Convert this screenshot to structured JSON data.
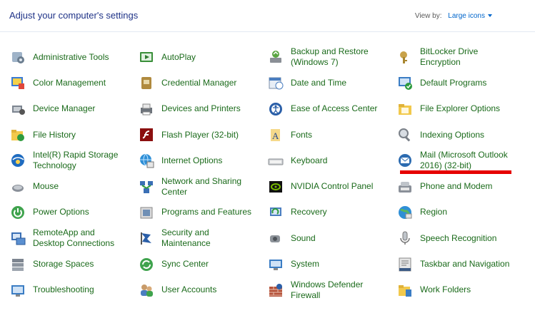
{
  "header": {
    "title": "Adjust your computer's settings",
    "view_by_label": "View by:",
    "view_by_value": "Large icons"
  },
  "colors": {
    "link_green": "#1a6a1a",
    "title_blue": "#1e3287",
    "accent_blue": "#0066cc",
    "annotation_red": "#e60000"
  },
  "items": [
    {
      "label": "Administrative Tools",
      "icon": "admin-tools-icon"
    },
    {
      "label": "AutoPlay",
      "icon": "autoplay-icon"
    },
    {
      "label": "Backup and Restore (Windows 7)",
      "icon": "backup-restore-icon"
    },
    {
      "label": "BitLocker Drive Encryption",
      "icon": "bitlocker-icon"
    },
    {
      "label": "Color Management",
      "icon": "color-management-icon"
    },
    {
      "label": "Credential Manager",
      "icon": "credential-manager-icon"
    },
    {
      "label": "Date and Time",
      "icon": "date-time-icon"
    },
    {
      "label": "Default Programs",
      "icon": "default-programs-icon"
    },
    {
      "label": "Device Manager",
      "icon": "device-manager-icon"
    },
    {
      "label": "Devices and Printers",
      "icon": "devices-printers-icon"
    },
    {
      "label": "Ease of Access Center",
      "icon": "ease-of-access-icon"
    },
    {
      "label": "File Explorer Options",
      "icon": "file-explorer-options-icon"
    },
    {
      "label": "File History",
      "icon": "file-history-icon"
    },
    {
      "label": "Flash Player (32-bit)",
      "icon": "flash-player-icon"
    },
    {
      "label": "Fonts",
      "icon": "fonts-icon"
    },
    {
      "label": "Indexing Options",
      "icon": "indexing-options-icon"
    },
    {
      "label": "Intel(R) Rapid Storage Technology",
      "icon": "intel-rst-icon"
    },
    {
      "label": "Internet Options",
      "icon": "internet-options-icon"
    },
    {
      "label": "Keyboard",
      "icon": "keyboard-icon"
    },
    {
      "label": "Mail (Microsoft Outlook 2016) (32-bit)",
      "icon": "mail-icon"
    },
    {
      "label": "Mouse",
      "icon": "mouse-icon"
    },
    {
      "label": "Network and Sharing Center",
      "icon": "network-sharing-icon"
    },
    {
      "label": "NVIDIA Control Panel",
      "icon": "nvidia-icon"
    },
    {
      "label": "Phone and Modem",
      "icon": "phone-modem-icon"
    },
    {
      "label": "Power Options",
      "icon": "power-options-icon"
    },
    {
      "label": "Programs and Features",
      "icon": "programs-features-icon"
    },
    {
      "label": "Recovery",
      "icon": "recovery-icon"
    },
    {
      "label": "Region",
      "icon": "region-icon"
    },
    {
      "label": "RemoteApp and Desktop Connections",
      "icon": "remoteapp-icon"
    },
    {
      "label": "Security and Maintenance",
      "icon": "security-maintenance-icon"
    },
    {
      "label": "Sound",
      "icon": "sound-icon"
    },
    {
      "label": "Speech Recognition",
      "icon": "speech-recognition-icon"
    },
    {
      "label": "Storage Spaces",
      "icon": "storage-spaces-icon"
    },
    {
      "label": "Sync Center",
      "icon": "sync-center-icon"
    },
    {
      "label": "System",
      "icon": "system-icon"
    },
    {
      "label": "Taskbar and Navigation",
      "icon": "taskbar-navigation-icon"
    },
    {
      "label": "Troubleshooting",
      "icon": "troubleshooting-icon"
    },
    {
      "label": "User Accounts",
      "icon": "user-accounts-icon"
    },
    {
      "label": "Windows Defender Firewall",
      "icon": "firewall-icon"
    },
    {
      "label": "Work Folders",
      "icon": "work-folders-icon"
    }
  ]
}
